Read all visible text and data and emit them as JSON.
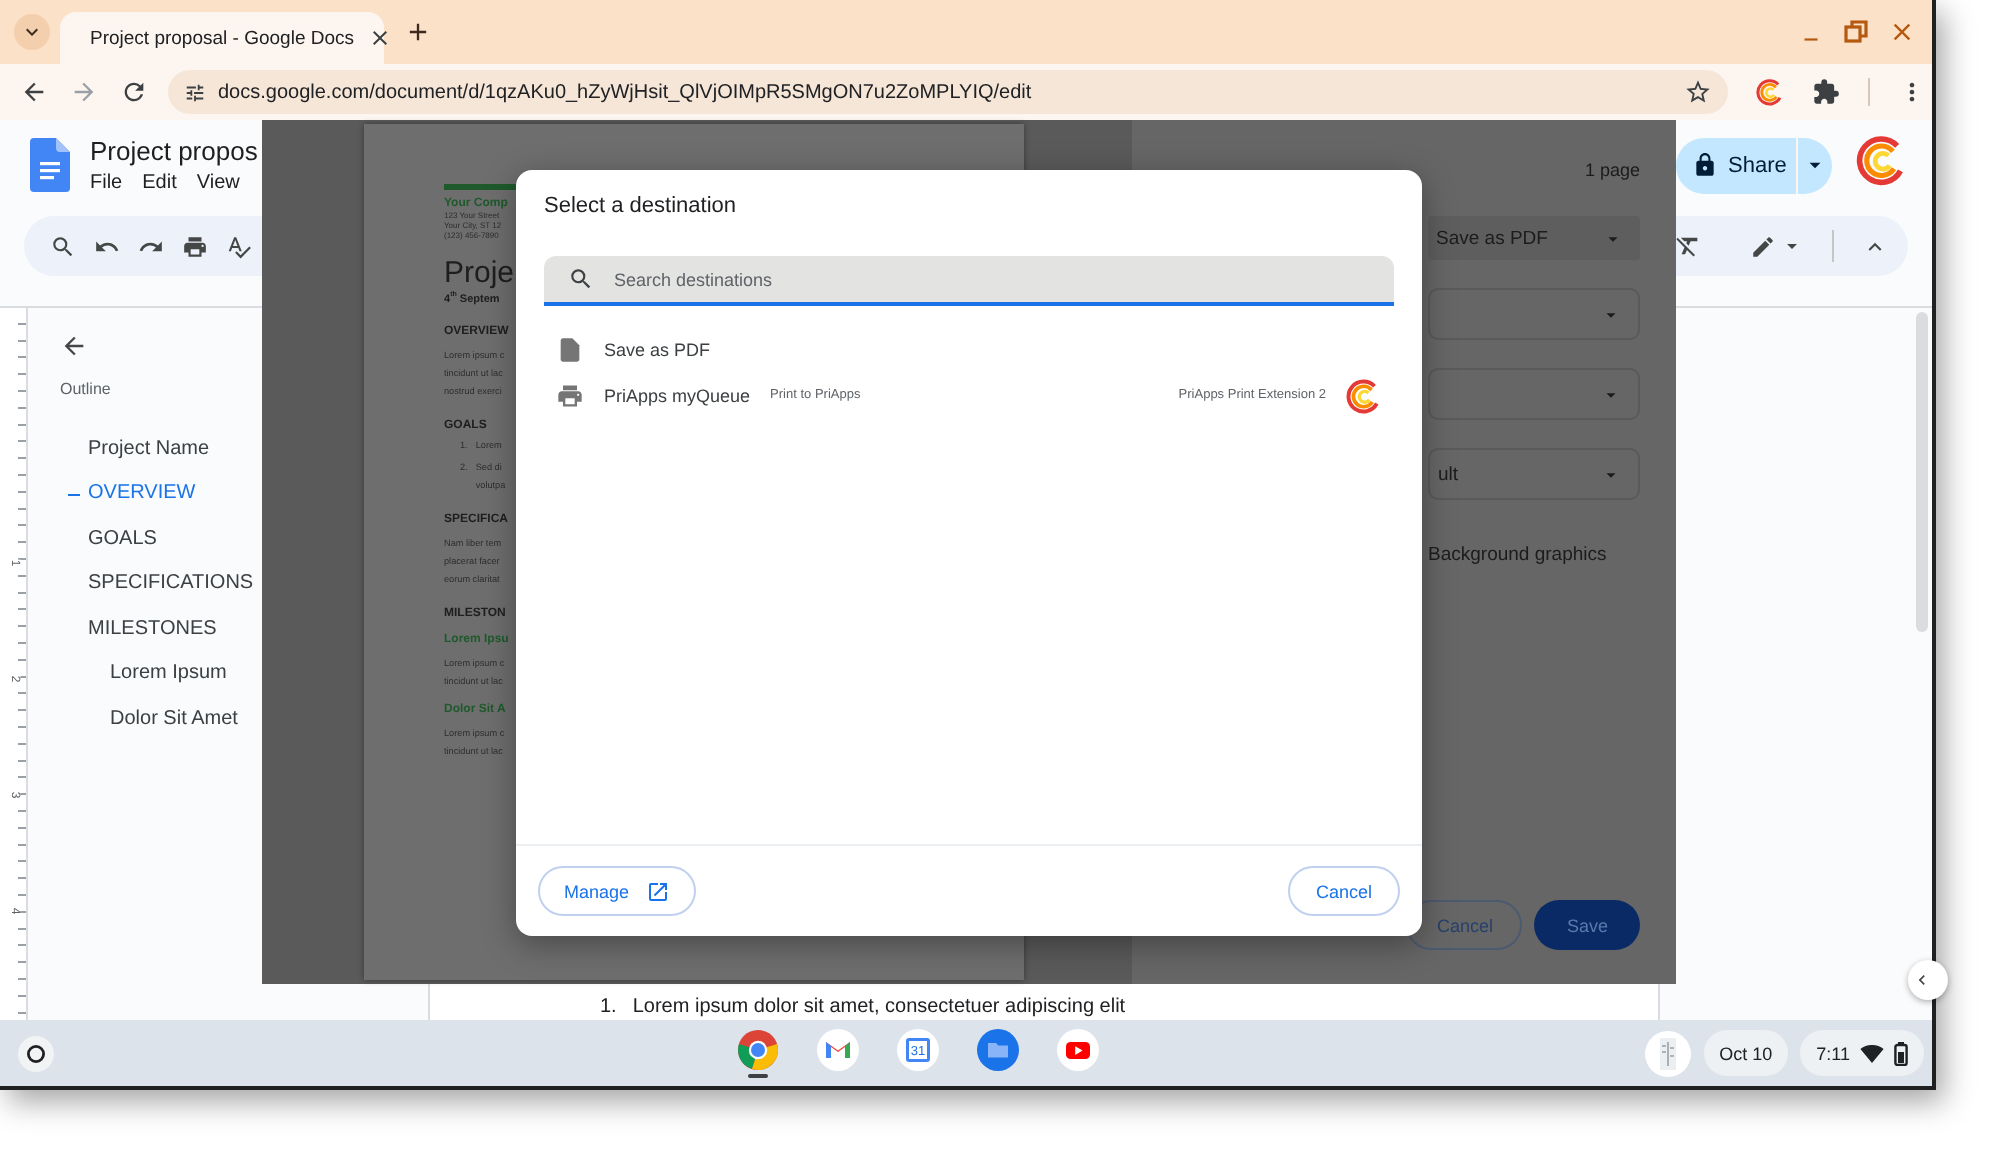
{
  "browser": {
    "tabs": [
      {
        "title": "Project proposal - Google Docs",
        "selected": true
      }
    ],
    "url": "docs.google.com/document/d/1qzAKu0_hZyWjHsit_QlVjOIMpR5SMgON7u2ZoMPLYIQ/edit"
  },
  "docs": {
    "title": "Project propos",
    "menus": [
      "File",
      "Edit",
      "View"
    ],
    "share": "Share"
  },
  "ruler_marks": [
    "1",
    "2",
    "3",
    "4"
  ],
  "outline": {
    "heading": "Outline",
    "items": [
      {
        "label": "Project Name",
        "selected": false
      },
      {
        "label": "OVERVIEW",
        "selected": true
      },
      {
        "label": "GOALS",
        "selected": false
      },
      {
        "label": "SPECIFICATIONS",
        "selected": false
      },
      {
        "label": "MILESTONES",
        "selected": false,
        "children": [
          {
            "label": "Lorem Ipsum",
            "selected": false
          },
          {
            "label": "Dolor Sit Amet",
            "selected": false
          }
        ]
      }
    ]
  },
  "document": {
    "list_item": {
      "number": "1.",
      "text": "Lorem ipsum dolor sit amet, consectetuer adipiscing elit"
    }
  },
  "print_preview": {
    "page": {
      "company": "Your Comp",
      "address": [
        "123 Your Street",
        "Your City, ST 12",
        "(123) 456-7890"
      ],
      "title": "Proje",
      "date": "4$^{th}$ Septem",
      "blocks": [
        {
          "kind": "heading",
          "text": "OVERVIEW"
        },
        {
          "kind": "paragraph",
          "lines": [
            "Lorem ipsum c",
            "tincidunt ut lac",
            "nostrud exerci"
          ]
        },
        {
          "kind": "heading",
          "text": "GOALS"
        },
        {
          "kind": "list_item",
          "number": "1.",
          "lines": [
            "Lorem"
          ]
        },
        {
          "kind": "list_item",
          "number": "2.",
          "lines": [
            "Sed di",
            "volutpa"
          ]
        },
        {
          "kind": "heading",
          "text": "SPECIFICA"
        },
        {
          "kind": "paragraph",
          "lines": [
            "Nam liber tem",
            "placerat facer",
            "eorum claritat"
          ]
        },
        {
          "kind": "heading",
          "text": "MILESTON"
        },
        {
          "kind": "subheading",
          "text": "Lorem Ipsu"
        },
        {
          "kind": "paragraph",
          "lines": [
            "Lorem ipsum c",
            "tincidunt ut lac"
          ]
        },
        {
          "kind": "subheading",
          "text": "Dolor Sit A"
        },
        {
          "kind": "paragraph",
          "lines": [
            "Lorem ipsum c",
            "tincidunt ut lac"
          ]
        }
      ]
    },
    "pages": "1 page",
    "destination": "Save as PDF",
    "options": [
      {
        "kind": "select"
      },
      {
        "kind": "select"
      },
      {
        "kind": "select",
        "value": "ult"
      },
      {
        "kind": "label",
        "text": "Background graphics"
      }
    ],
    "buttons": [
      "Cancel",
      "Save"
    ]
  },
  "dialog": {
    "title": "Select a destination",
    "search_placeholder": "Search destinations",
    "destinations": [
      {
        "kind": "pdf",
        "name": "Save as PDF"
      },
      {
        "kind": "printer",
        "name": "PriApps myQueue",
        "description": "Print to PriApps",
        "extension": "PriApps Print Extension 2"
      }
    ],
    "manage": "Manage",
    "cancel": "Cancel"
  },
  "shelf": {
    "apps": [
      {
        "kind": "chrome",
        "running": true
      },
      {
        "kind": "gmail",
        "running": false
      },
      {
        "kind": "calendar",
        "label": "31",
        "running": false
      },
      {
        "kind": "files",
        "running": false
      },
      {
        "kind": "youtube",
        "running": false
      }
    ],
    "date": "Oct 10",
    "time": "7:11"
  }
}
